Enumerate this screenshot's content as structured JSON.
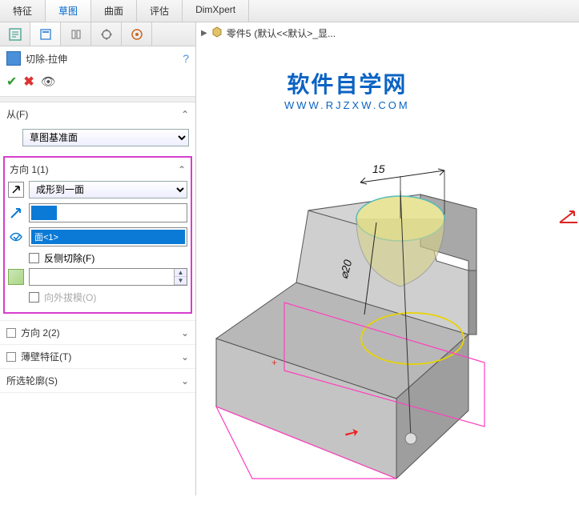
{
  "ribbon": {
    "tabs": [
      "特征",
      "草图",
      "曲面",
      "评估",
      "DimXpert"
    ],
    "active_index": 1
  },
  "view_icons": [
    "zoom-fit-icon",
    "zoom-area-icon",
    "rotate-icon",
    "section-icon",
    "display-icon",
    "view-orientation-icon"
  ],
  "panel_tabs": [
    "feature-manager-icon",
    "property-manager-icon",
    "config-manager-icon",
    "dimxpert-icon",
    "display-manager-icon"
  ],
  "feature": {
    "name": "切除-拉伸",
    "help": "?",
    "ok": "✔",
    "cancel": "✖",
    "eye": "👁"
  },
  "from": {
    "label": "从(F)",
    "value": "草图基准面"
  },
  "dir1": {
    "label": "方向 1(1)",
    "end_condition": "成形到一面",
    "direction_field": "",
    "face_field": "面<1>",
    "reverse_label": "反侧切除(F)",
    "draft_outward_label": "向外拔模(O)"
  },
  "dir2": {
    "label": "方向 2(2)"
  },
  "thin": {
    "label": "薄壁特征(T)"
  },
  "contours": {
    "label": "所选轮廓(S)"
  },
  "breadcrumb": {
    "part": "零件5",
    "state": "(默认<<默认>_显..."
  },
  "watermark": {
    "title": "软件自学网",
    "url": "WWW.RJZXW.COM"
  },
  "dimensions": {
    "d15": "15",
    "d20": "⌀20"
  }
}
